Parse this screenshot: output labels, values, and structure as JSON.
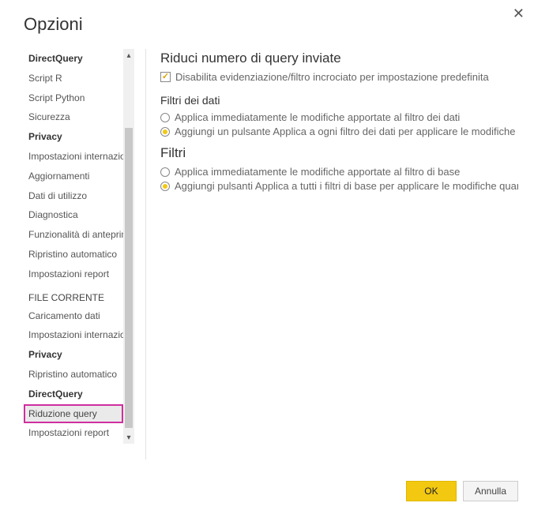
{
  "dialog": {
    "title": "Opzioni",
    "ok": "OK",
    "cancel": "Annulla"
  },
  "sidebar": {
    "items": [
      {
        "label": "DirectQuery",
        "bold": true
      },
      {
        "label": "Script R"
      },
      {
        "label": "Script Python"
      },
      {
        "label": "Sicurezza"
      },
      {
        "label": "Privacy",
        "bold": true
      },
      {
        "label": "Impostazioni internazionali"
      },
      {
        "label": "Aggiornamenti"
      },
      {
        "label": "Dati di utilizzo"
      },
      {
        "label": "Diagnostica"
      },
      {
        "label": "Funzionalità di anteprima"
      },
      {
        "label": "Ripristino automatico"
      },
      {
        "label": "Impostazioni report"
      }
    ],
    "group2_header": "FILE CORRENTE",
    "items2": [
      {
        "label": "Caricamento dati"
      },
      {
        "label": "Impostazioni internazionali"
      },
      {
        "label": "Privacy",
        "bold": true
      },
      {
        "label": "Ripristino automatico"
      },
      {
        "label": "DirectQuery",
        "bold": true
      },
      {
        "label": "Riduzione query",
        "selected": true
      },
      {
        "label": "Impostazioni report"
      }
    ]
  },
  "content": {
    "h1": "Riduci numero di query inviate",
    "cb1": "Disabilita evidenziazione/filtro incrociato per impostazione predefinita",
    "h2": "Filtri dei dati",
    "r1a": "Applica immediatamente le modifiche apportate al filtro dei dati",
    "r1b": "Aggiungi un pulsante Applica a ogni filtro dei dati per applicare le modifiche qu",
    "h3": "Filtri",
    "r2a": "Applica immediatamente le modifiche apportate al filtro di base",
    "r2b": "Aggiungi pulsanti Applica a tutti i filtri di base per applicare le modifiche quand"
  }
}
